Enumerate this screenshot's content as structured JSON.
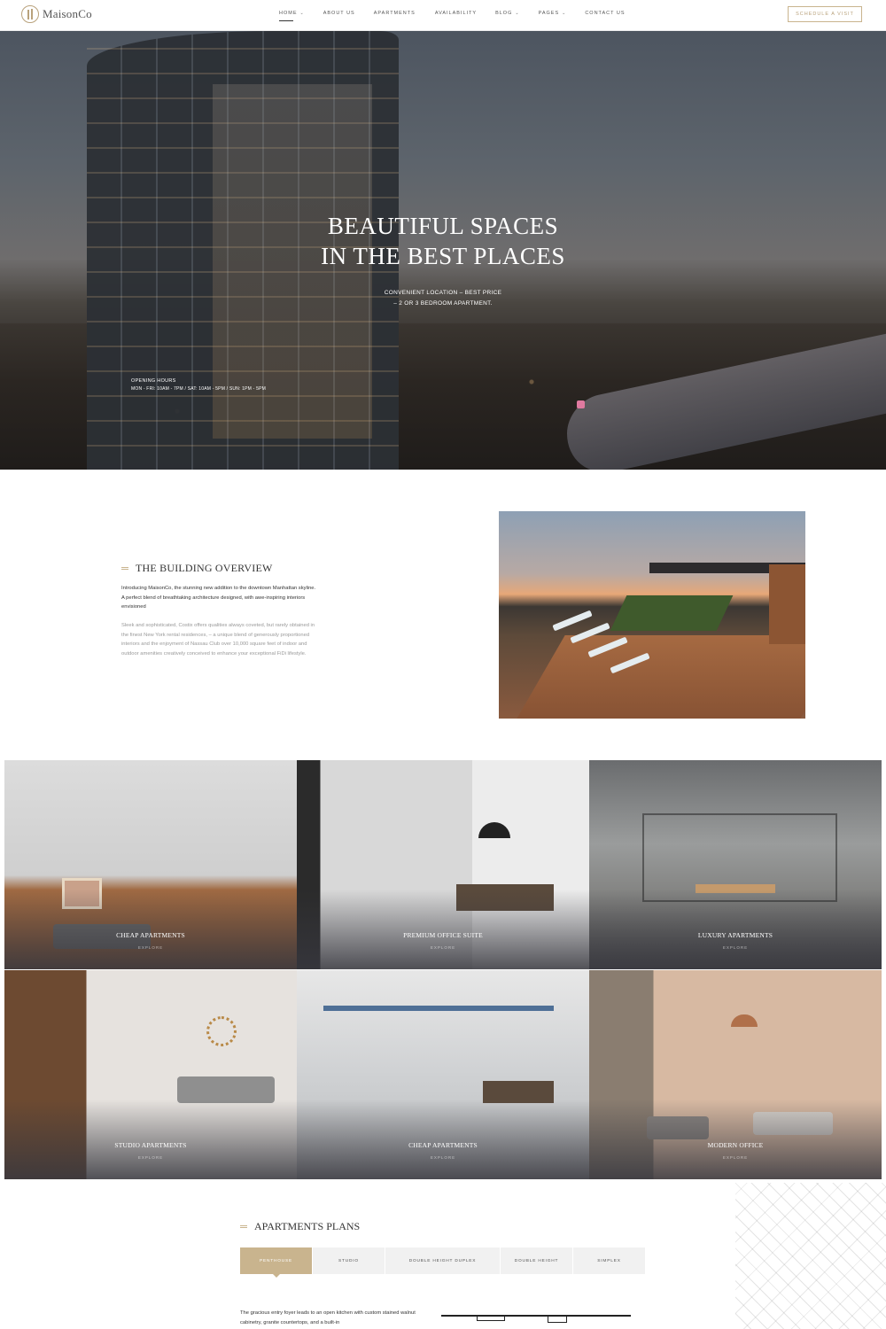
{
  "header": {
    "logo_text": "MaisonCo",
    "nav": [
      {
        "label": "HOME",
        "dropdown": true,
        "active": true
      },
      {
        "label": "ABOUT US",
        "dropdown": false
      },
      {
        "label": "APARTMENTS",
        "dropdown": false
      },
      {
        "label": "AVAILABILITY",
        "dropdown": false
      },
      {
        "label": "BLOG",
        "dropdown": true
      },
      {
        "label": "PAGES",
        "dropdown": true
      },
      {
        "label": "CONTACT US",
        "dropdown": false
      }
    ],
    "cta_label": "SCHEDULE A VISIT"
  },
  "hero": {
    "title_line1": "BEAUTIFUL SPACES",
    "title_line2": "IN THE BEST PLACES",
    "subtitle_line1": "CONVENIENT LOCATION – BEST PRICE",
    "subtitle_line2": "– 2 OR 3 BEDROOM APARTMENT.",
    "hours_label": "OPENING HOURS",
    "hours_value": "MON - FRI: 10AM - 7PM / SAT: 10AM - 5PM / SUN: 1PM - 5PM"
  },
  "overview": {
    "title": "THE BUILDING OVERVIEW",
    "paragraph1": "Introducing MaisonCo, the stunning new addition to the downtown Manhattan skyline. A perfect blend of breathtaking architecture designed, with awe-inspiring interiors envisioned",
    "paragraph2": "Sleek and sophisticated, Costix offers qualities always coveted, but rarely obtained in the finest New York rental residences, – a unique blend of generously proportioned interiors and the enjoyment of Nassau Club over 10,000 square feet of indoor and outdoor amenities creatively conceived to enhance your exceptional FiDi lifestyle."
  },
  "tiles": [
    {
      "title": "CHEAP APARTMENTS",
      "action": "EXPLORE"
    },
    {
      "title": "PREMIUM OFFICE SUITE",
      "action": "EXPLORE"
    },
    {
      "title": "LUXURY APARTMENTS",
      "action": "EXPLORE"
    },
    {
      "title": "STUDIO APARTMENTS",
      "action": "EXPLORE"
    },
    {
      "title": "CHEAP APARTMENTS",
      "action": "EXPLORE"
    },
    {
      "title": "MODERN OFFICE",
      "action": "EXPLORE"
    }
  ],
  "plans": {
    "title": "APARTMENTS PLANS",
    "tabs": [
      {
        "label": "PENTHOUSE",
        "active": true
      },
      {
        "label": "STUDIO",
        "active": false
      },
      {
        "label": "DOUBLE HEIGHT DUPLEX",
        "active": false
      },
      {
        "label": "DOUBLE HEIGHT",
        "active": false
      },
      {
        "label": "SIMPLEX",
        "active": false
      }
    ],
    "description": "The gracious entry foyer leads to an open kitchen with custom stained walnut cabinetry, granite countertops, and a built-in"
  },
  "colors": {
    "accent": "#c9b48e",
    "accent_text": "#b9a27c",
    "text": "#333333",
    "muted": "#999999"
  },
  "icons": [
    "logo-mark-icon",
    "chevron-down-icon",
    "double-dash-icon",
    "map-pin-icon"
  ]
}
